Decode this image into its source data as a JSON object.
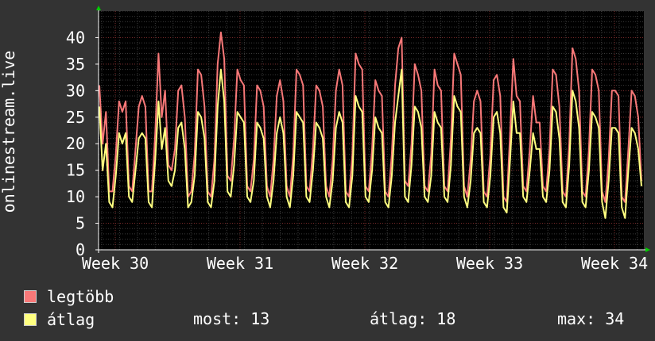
{
  "chart_data": {
    "type": "line",
    "ylabel": "onlinestream.live",
    "ylim": [
      0,
      45
    ],
    "yticks": [
      0,
      5,
      10,
      15,
      20,
      25,
      30,
      35,
      40
    ],
    "xticks": [
      "Week 30",
      "Week 31",
      "Week 32",
      "Week 33",
      "Week 34"
    ],
    "grid": true,
    "colors": {
      "background": "#333333",
      "plot": "#000000",
      "grid_minor": "#3a3a3a",
      "grid_major": "#7a2a2a",
      "axis_arrow": "#00cc00"
    },
    "series": [
      {
        "name": "legtöbb",
        "color": "#f87878",
        "values": [
          31,
          20,
          26,
          11,
          11,
          18,
          28,
          26,
          28,
          12,
          11,
          19,
          27,
          29,
          27,
          11,
          11,
          22,
          37,
          25,
          30,
          16,
          15,
          19,
          30,
          31,
          25,
          10,
          11,
          18,
          34,
          33,
          27,
          11,
          10,
          17,
          35,
          41,
          36,
          14,
          13,
          21,
          34,
          32,
          31,
          12,
          11,
          17,
          31,
          30,
          27,
          12,
          10,
          17,
          29,
          32,
          28,
          12,
          10,
          18,
          34,
          33,
          31,
          12,
          11,
          19,
          31,
          30,
          27,
          12,
          10,
          17,
          30,
          34,
          31,
          11,
          10,
          18,
          37,
          35,
          34,
          12,
          11,
          19,
          32,
          30,
          29,
          11,
          10,
          18,
          31,
          38,
          40,
          13,
          12,
          20,
          35,
          33,
          30,
          12,
          11,
          18,
          34,
          31,
          30,
          12,
          11,
          21,
          37,
          35,
          33,
          12,
          10,
          17,
          28,
          30,
          28,
          11,
          10,
          18,
          32,
          33,
          29,
          10,
          9,
          22,
          36,
          29,
          28,
          12,
          11,
          19,
          29,
          24,
          24,
          12,
          11,
          19,
          34,
          33,
          27,
          11,
          10,
          20,
          38,
          36,
          30,
          11,
          10,
          19,
          34,
          33,
          30,
          11,
          9,
          17,
          30,
          30,
          29,
          10,
          9,
          19,
          30,
          29,
          25,
          13
        ]
      },
      {
        "name": "átlag",
        "color": "#ffff80",
        "values": [
          27,
          15,
          20,
          9,
          8,
          14,
          22,
          20,
          22,
          10,
          9,
          15,
          21,
          22,
          21,
          9,
          8,
          17,
          28,
          19,
          23,
          13,
          12,
          15,
          23,
          24,
          19,
          8,
          9,
          14,
          26,
          25,
          21,
          9,
          8,
          13,
          27,
          34,
          28,
          11,
          10,
          16,
          26,
          25,
          24,
          10,
          9,
          13,
          24,
          23,
          21,
          10,
          8,
          13,
          22,
          25,
          22,
          10,
          8,
          14,
          26,
          25,
          24,
          10,
          9,
          15,
          24,
          23,
          21,
          10,
          8,
          13,
          23,
          26,
          24,
          9,
          8,
          14,
          29,
          27,
          26,
          10,
          9,
          15,
          25,
          23,
          22,
          9,
          8,
          14,
          24,
          29,
          34,
          10,
          9,
          16,
          27,
          26,
          23,
          10,
          9,
          14,
          26,
          24,
          23,
          10,
          9,
          16,
          29,
          27,
          26,
          10,
          8,
          13,
          22,
          23,
          22,
          9,
          8,
          14,
          25,
          26,
          22,
          8,
          7,
          17,
          28,
          22,
          22,
          10,
          9,
          15,
          22,
          19,
          19,
          10,
          9,
          15,
          27,
          26,
          21,
          9,
          8,
          16,
          30,
          28,
          23,
          9,
          8,
          15,
          26,
          25,
          23,
          9,
          6,
          13,
          23,
          23,
          22,
          8,
          6,
          15,
          23,
          22,
          19,
          12
        ]
      }
    ]
  },
  "legend": {
    "max_label": "legtöbb",
    "avg_label": "átlag",
    "most": "most: 13",
    "atlag": "átlag: 18",
    "max": "max: 34"
  }
}
